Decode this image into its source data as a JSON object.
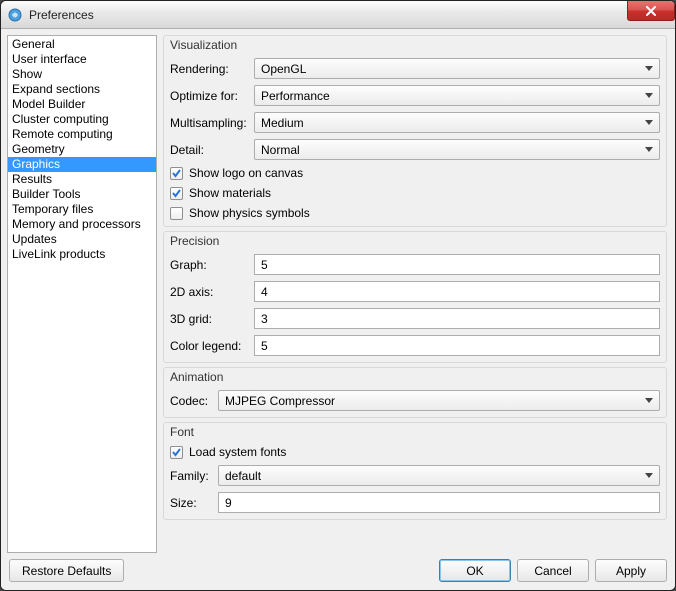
{
  "window": {
    "title": "Preferences",
    "close_label": "✕"
  },
  "nav": {
    "items": [
      "General",
      "User interface",
      "Show",
      "Expand sections",
      "Model Builder",
      "Cluster computing",
      "Remote computing",
      "Geometry",
      "Graphics",
      "Results",
      "Builder Tools",
      "Temporary files",
      "Memory and processors",
      "Updates",
      "LiveLink products"
    ],
    "selected_index": 8
  },
  "visualization": {
    "title": "Visualization",
    "rendering_label": "Rendering:",
    "rendering_value": "OpenGL",
    "optimize_label": "Optimize for:",
    "optimize_value": "Performance",
    "multisampling_label": "Multisampling:",
    "multisampling_value": "Medium",
    "detail_label": "Detail:",
    "detail_value": "Normal",
    "show_logo_label": "Show logo on canvas",
    "show_logo_checked": true,
    "show_materials_label": "Show materials",
    "show_materials_checked": true,
    "show_physics_label": "Show physics symbols",
    "show_physics_checked": false
  },
  "precision": {
    "title": "Precision",
    "graph_label": "Graph:",
    "graph_value": "5",
    "axis2d_label": "2D axis:",
    "axis2d_value": "4",
    "grid3d_label": "3D grid:",
    "grid3d_value": "3",
    "colorlegend_label": "Color legend:",
    "colorlegend_value": "5"
  },
  "animation": {
    "title": "Animation",
    "codec_label": "Codec:",
    "codec_value": "MJPEG Compressor"
  },
  "font": {
    "title": "Font",
    "load_fonts_label": "Load system fonts",
    "load_fonts_checked": true,
    "family_label": "Family:",
    "family_value": "default",
    "size_label": "Size:",
    "size_value": "9"
  },
  "buttons": {
    "restore": "Restore Defaults",
    "ok": "OK",
    "cancel": "Cancel",
    "apply": "Apply"
  }
}
